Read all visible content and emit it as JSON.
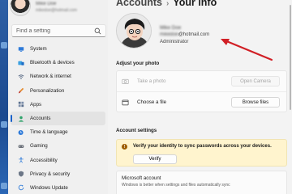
{
  "sidebar": {
    "profile": {
      "name": "Mike Doe",
      "email": "mikedoe@hotmail.com"
    },
    "search": {
      "placeholder": "Find a setting"
    },
    "items": [
      {
        "label": "System",
        "icon": "monitor-icon",
        "active": false
      },
      {
        "label": "Bluetooth & devices",
        "icon": "bluetooth-icon",
        "active": false
      },
      {
        "label": "Network & internet",
        "icon": "wifi-icon",
        "active": false
      },
      {
        "label": "Personalization",
        "icon": "brush-icon",
        "active": false
      },
      {
        "label": "Apps",
        "icon": "apps-icon",
        "active": false
      },
      {
        "label": "Accounts",
        "icon": "person-icon",
        "active": true
      },
      {
        "label": "Time & language",
        "icon": "globe-clock-icon",
        "active": false
      },
      {
        "label": "Gaming",
        "icon": "gamepad-icon",
        "active": false
      },
      {
        "label": "Accessibility",
        "icon": "accessibility-icon",
        "active": false
      },
      {
        "label": "Privacy & security",
        "icon": "shield-icon",
        "active": false
      },
      {
        "label": "Windows Update",
        "icon": "update-icon",
        "active": false
      }
    ]
  },
  "header": {
    "breadcrumb": "Accounts",
    "separator": "›",
    "title": "Your info"
  },
  "account": {
    "name": "Mike Doe",
    "email_user": "mikedoe",
    "email_domain": "@hotmail.com",
    "role": "Administrator"
  },
  "photo": {
    "heading": "Adjust your photo",
    "take_photo_label": "Take a photo",
    "open_camera_label": "Open Camera",
    "choose_file_label": "Choose a file",
    "browse_files_label": "Browse files"
  },
  "settings": {
    "heading": "Account settings",
    "verify_text": "Verify your identity to sync passwords across your devices.",
    "verify_button": "Verify",
    "ms_title": "Microsoft account",
    "ms_desc": "Windows is better when settings and files automatically sync"
  },
  "colors": {
    "accent": "#1a62c9",
    "arrow": "#d11f25",
    "warning_bg": "#fff4ce",
    "warning_icon": "#9d5d00"
  }
}
